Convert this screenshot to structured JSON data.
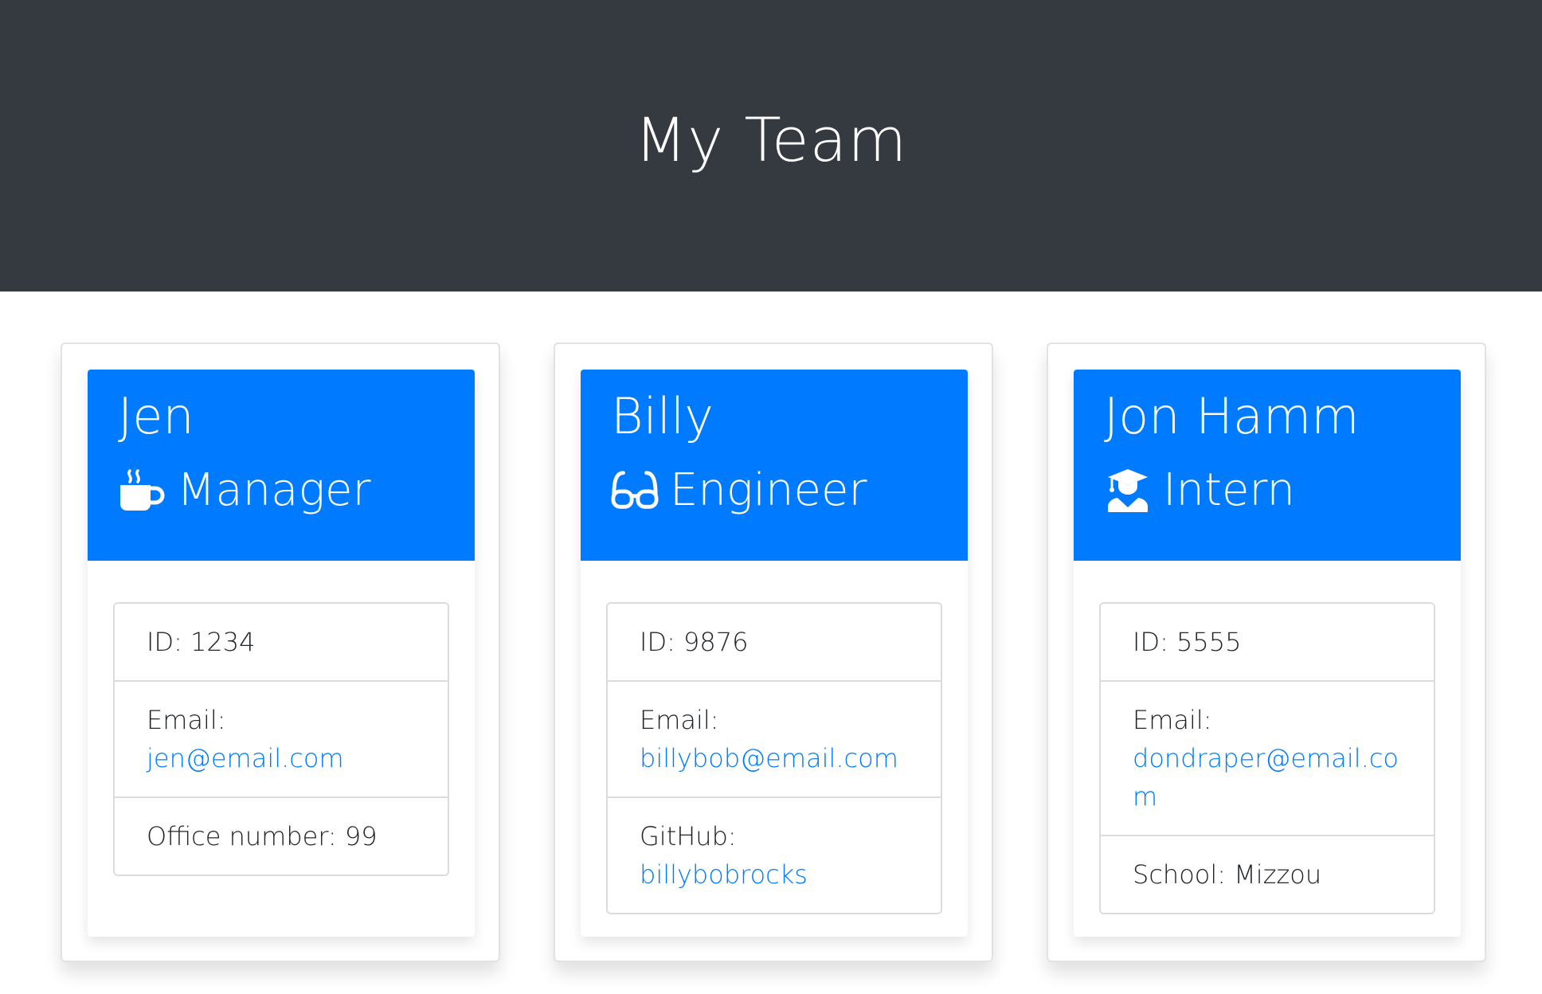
{
  "header": {
    "title": "My Team"
  },
  "colors": {
    "header_bg": "#343a40",
    "card_head_bg": "#007bff",
    "link": "#007bff"
  },
  "employees": [
    {
      "name": "Jen",
      "role": "Manager",
      "role_icon": "coffee-mug-icon",
      "id_label": "ID: 1234",
      "email_label": "Email:",
      "email": "jen@email.com",
      "extra_label": "Office number: 99",
      "extra_value": ""
    },
    {
      "name": "Billy",
      "role": "Engineer",
      "role_icon": "glasses-icon",
      "id_label": "ID: 9876",
      "email_label": "Email:",
      "email": "billybob@email.com",
      "extra_label": "GitHub:",
      "extra_value": "billybobrocks"
    },
    {
      "name": "Jon Hamm",
      "role": "Intern",
      "role_icon": "graduate-icon",
      "id_label": "ID: 5555",
      "email_label": "Email:",
      "email": "dondraper@email.com",
      "extra_label": "School: Mizzou",
      "extra_value": ""
    }
  ]
}
